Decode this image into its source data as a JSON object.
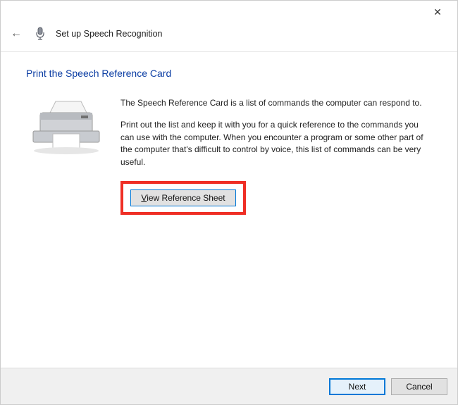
{
  "titlebar": {
    "close_label": "✕"
  },
  "header": {
    "back_glyph": "←",
    "title": "Set up Speech Recognition"
  },
  "page": {
    "heading": "Print the Speech Reference Card",
    "paragraph1": "The Speech Reference Card is a list of commands the computer can respond to.",
    "paragraph2": "Print out the list and keep it with you for a quick reference to the commands you can use with the computer. When you encounter a program or some other part of the computer that's difficult to control by voice, this list of commands can be very useful.",
    "view_button_prefix": "V",
    "view_button_rest": "iew Reference Sheet"
  },
  "footer": {
    "next": "Next",
    "cancel": "Cancel"
  },
  "colors": {
    "accent": "#0078d7",
    "heading": "#0a3ca3",
    "highlight": "#ef2e25"
  }
}
